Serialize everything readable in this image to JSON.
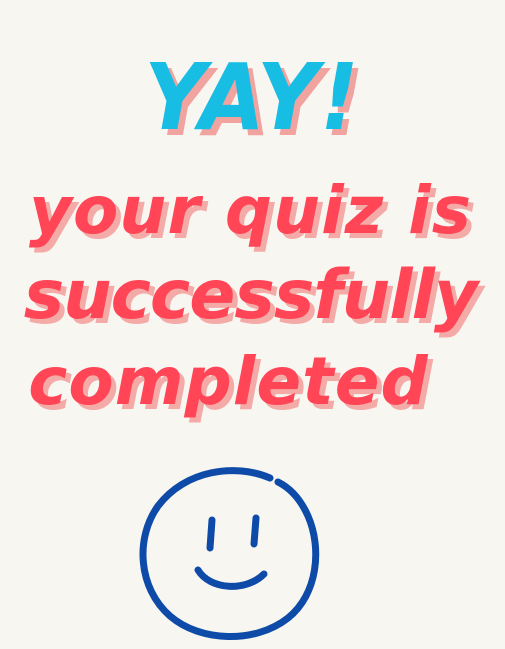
{
  "headline": {
    "exclaim": "YAY!",
    "line1": "your quiz is",
    "line2": "successfully",
    "line3": "completed"
  },
  "colors": {
    "background": "#f8f6f1",
    "exclaim": "#17bde3",
    "message": "#ff4556",
    "shadow": "#f4aaa7",
    "smiley": "#0e4ba8"
  },
  "icons": {
    "smiley": "smiley-face-icon"
  }
}
